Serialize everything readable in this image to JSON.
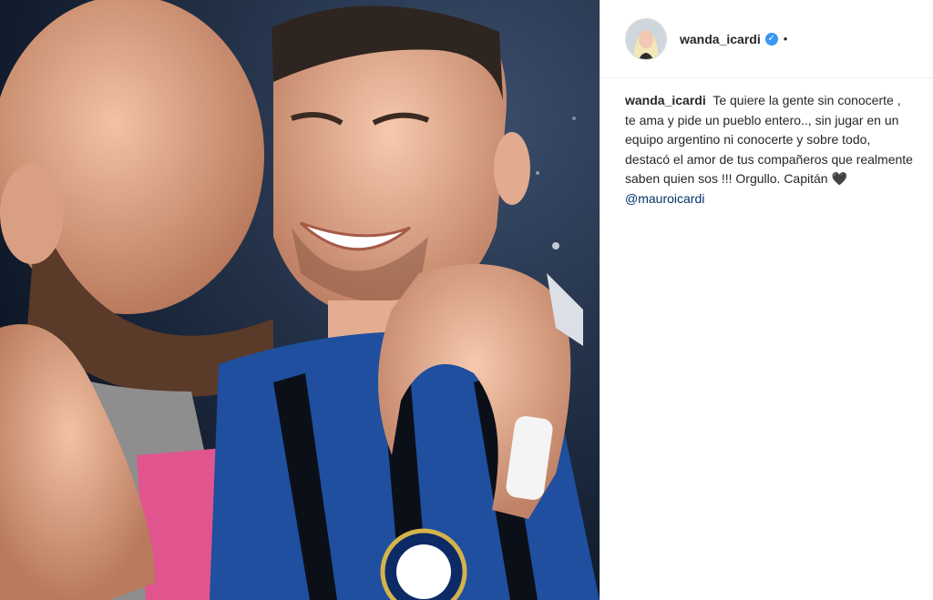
{
  "post": {
    "username": "wanda_icardi",
    "verified_icon": "verified-badge-icon",
    "separator": "•",
    "caption": {
      "username": "wanda_icardi",
      "text": "Te quiere la gente sin conocerte , te ama y pide un pueblo entero.., sin jugar en un equipo argentino ni conocerte y sobre todo, destacó el amor de tus compañeros que realmente saben quien sos !!! Orgullo. Capitán 🖤",
      "mention": "@mauroicardi"
    }
  },
  "colors": {
    "accent": "#3897f0",
    "mention": "#003569",
    "text": "#262626"
  }
}
